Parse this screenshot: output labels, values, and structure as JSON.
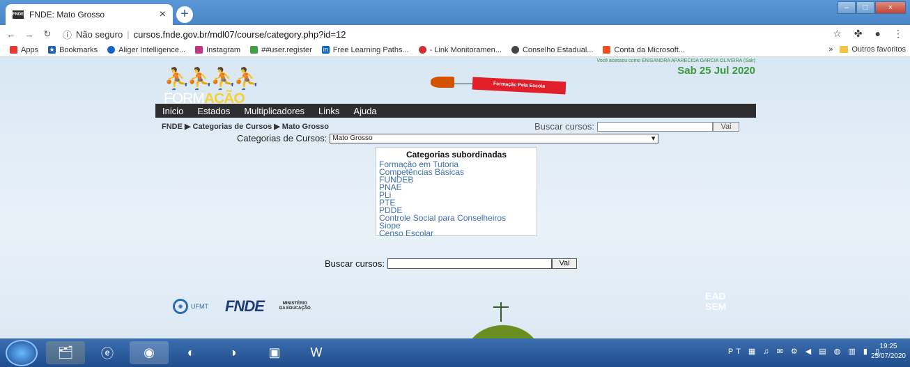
{
  "browser": {
    "tab_title": "FNDE: Mato Grosso",
    "favicon_text": "FNDE",
    "url_security": "Não seguro",
    "url": "cursos.fnde.gov.br/mdl07/course/category.php?id=12",
    "bookmarks": [
      {
        "label": "Apps",
        "color": "#e53935"
      },
      {
        "label": "Bookmarks",
        "color": "#1e5eb8"
      },
      {
        "label": "Aliger Intelligence...",
        "color": "#1565c0"
      },
      {
        "label": "Instagram",
        "color": "#c13584"
      },
      {
        "label": "##user.register",
        "color": "#43a047"
      },
      {
        "label": "Free Learning Paths...",
        "color": "#0a66c2"
      },
      {
        "label": "- Link Monitoramen...",
        "color": "#d32f2f"
      },
      {
        "label": "Conselho Estadual...",
        "color": "#444444"
      },
      {
        "label": "Conta da Microsoft...",
        "color": "#f25022"
      }
    ],
    "bookmarks_overflow": "»",
    "other_bookmarks": "Outros favoritos"
  },
  "site": {
    "logo_text_light": "FORM",
    "logo_text_bold": "AÇÃO",
    "banner_text": "Formação Pela Escola",
    "user_line": "Você acessou como ENISANDRA APARECIDA GARCIA OLIVEIRA (Sair)",
    "date": "Sab 25 Jul 2020",
    "menu": [
      "Inicio",
      "Estados",
      "Multiplicadores",
      "Links",
      "Ajuda"
    ],
    "breadcrumb": "FNDE ▶ Categorias de Cursos ▶ Mato Grosso",
    "search_label": "Buscar cursos:",
    "search_button": "Vai",
    "categories_label": "Categorias de Cursos:",
    "categories_selected": "Mato Grosso",
    "subcategories_title": "Categorias subordinadas",
    "subcategories": [
      "Formação em Tutoria",
      "Competências Básicas",
      "FUNDEB",
      "PNAE",
      "PLi",
      "PTE",
      "PDDE",
      "Controle Social para Conselheiros",
      "Siope",
      "Censo Escolar"
    ],
    "footer": {
      "ufmt": "UFMT",
      "fnde": "FNDE",
      "mec_line1": "MINISTÉRIO",
      "mec_line2": "DA EDUCAÇÃO",
      "ead_line1": "EAD",
      "ead_line2": "SEM"
    }
  },
  "taskbar": {
    "tray_lang": "PT",
    "time": "19:25",
    "date": "25/07/2020"
  }
}
